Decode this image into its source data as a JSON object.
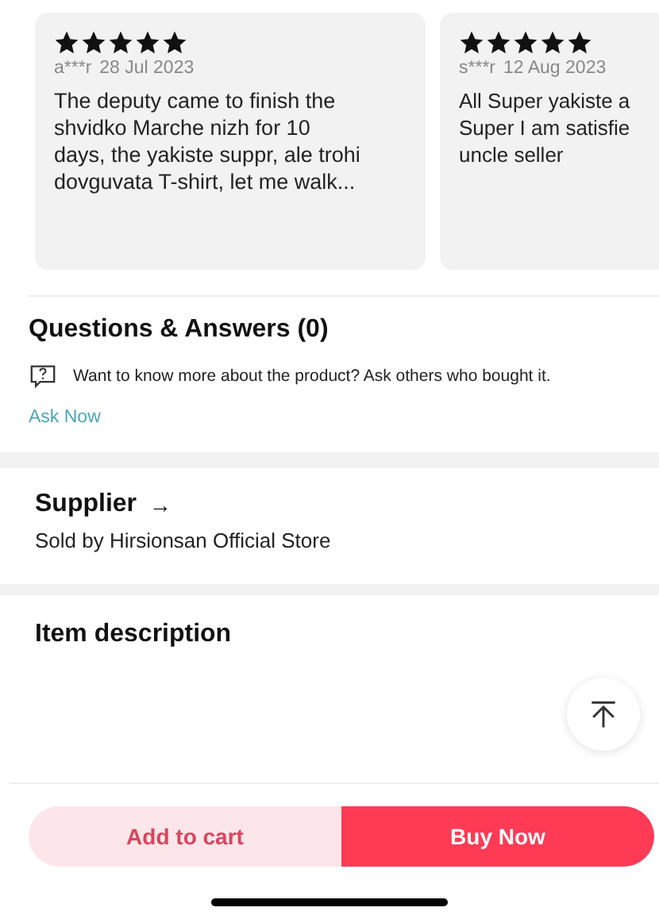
{
  "reviews": [
    {
      "stars": 5,
      "author": "a***r",
      "date": "28 Jul 2023",
      "text": "The deputy came to finish the\nshvidko Marche nizh for 10\ndays, the yakiste suppr, ale trohi\ndovguvata T-shirt, let me walk..."
    },
    {
      "stars": 5,
      "author": "s***r",
      "date": "12 Aug 2023",
      "text": "All Super yakiste a\nSuper I am satisfie\nuncle seller"
    }
  ],
  "questions": {
    "title": "Questions & Answers (0)",
    "prompt": "Want to know more about the product? Ask others who bought it.",
    "link": "Ask Now"
  },
  "supplier": {
    "title": "Supplier",
    "arrow": "→",
    "store": "Sold by Hirsionsan Official Store"
  },
  "description": {
    "title": "Item description"
  },
  "actions": {
    "add_to_cart": "Add to cart",
    "buy_now": "Buy Now"
  }
}
